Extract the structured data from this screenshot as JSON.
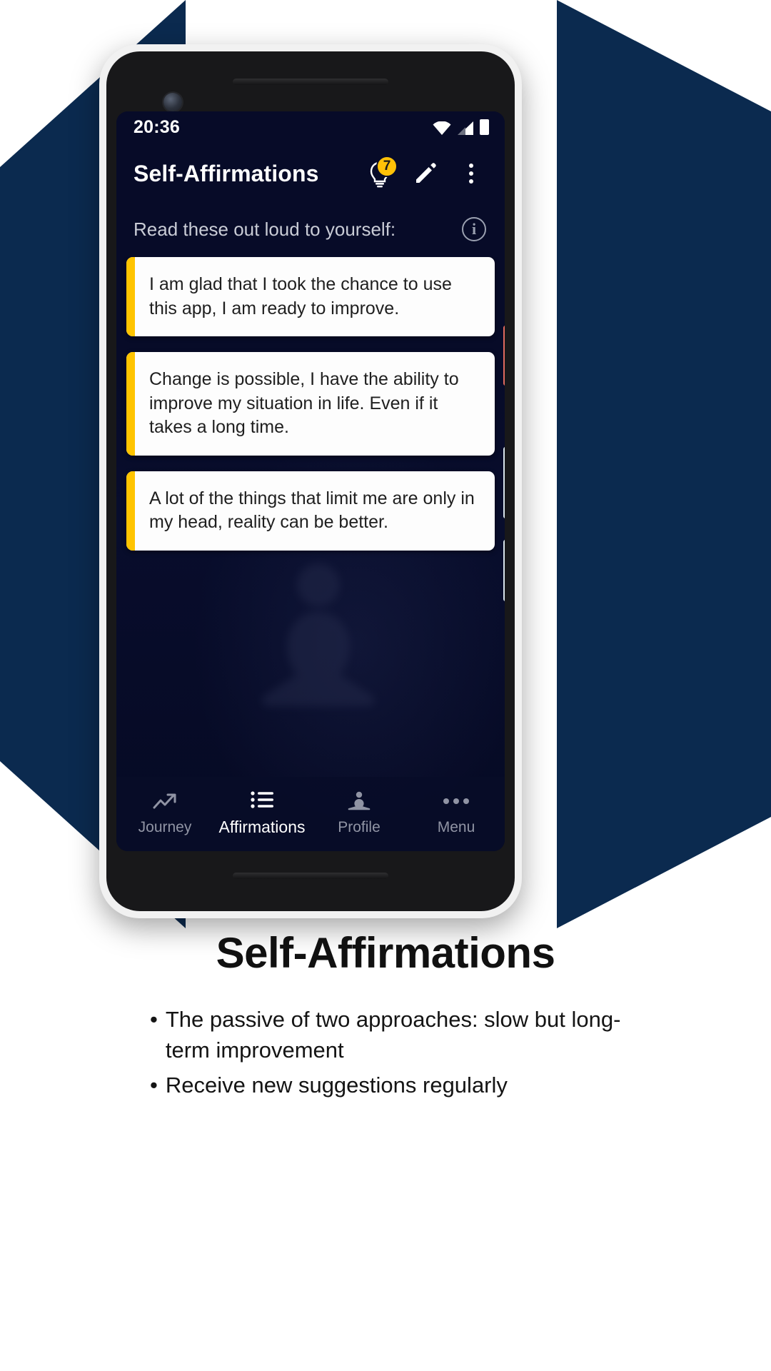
{
  "statusbar": {
    "time": "20:36",
    "icons": [
      "wifi-icon",
      "cellular-signal-icon",
      "battery-icon"
    ]
  },
  "appbar": {
    "title": "Self-Affirmations",
    "lightbulb_badge_count": "7",
    "actions": [
      "lightbulb-icon",
      "edit-pencil-icon",
      "overflow-menu-icon"
    ]
  },
  "content": {
    "instruction": "Read these out loud to yourself:",
    "info_icon_glyph": "i",
    "affirmations": [
      "I am glad that I took the chance to use this app, I am ready to improve.",
      "Change is possible, I have the ability to improve my situation in life. Even if it takes a long time.",
      "A lot of the things that limit me are only in my head, reality can be better."
    ]
  },
  "bottom_nav": {
    "items": [
      {
        "label": "Journey",
        "icon": "trending-up-icon",
        "active": false
      },
      {
        "label": "Affirmations",
        "icon": "list-icon",
        "active": true
      },
      {
        "label": "Profile",
        "icon": "meditation-person-icon",
        "active": false
      },
      {
        "label": "Menu",
        "icon": "more-horizontal-icon",
        "active": false
      }
    ]
  },
  "caption": {
    "title": "Self-Affirmations",
    "bullets": [
      "The passive of two approaches: slow but long-term improvement",
      "Receive new suggestions regularly"
    ],
    "bullet_glyph": "•"
  },
  "colors": {
    "accent_yellow": "#FFC400",
    "screen_navy": "#070B28",
    "page_navy": "#0B2A4F",
    "card_white": "#FDFDFD"
  }
}
